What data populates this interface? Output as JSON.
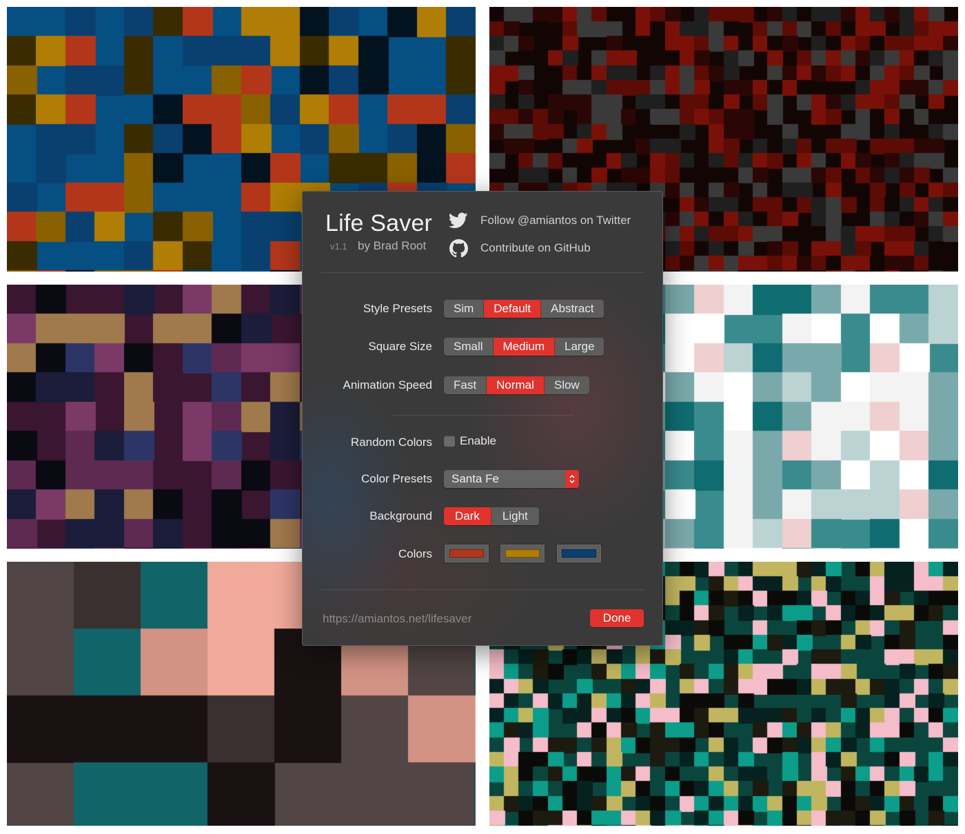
{
  "dialog": {
    "title": "Life Saver",
    "version": "v1.1",
    "author": "by Brad Root",
    "twitter_label": "Follow @amiantos on Twitter",
    "github_label": "Contribute on GitHub",
    "style_presets": {
      "label": "Style Presets",
      "options": [
        "Sim",
        "Default",
        "Abstract"
      ],
      "selected": "Default"
    },
    "square_size": {
      "label": "Square Size",
      "options": [
        "Small",
        "Medium",
        "Large"
      ],
      "selected": "Medium"
    },
    "animation_speed": {
      "label": "Animation Speed",
      "options": [
        "Fast",
        "Normal",
        "Slow"
      ],
      "selected": "Normal"
    },
    "random_colors": {
      "label": "Random Colors",
      "checkbox_label": "Enable",
      "checked": false
    },
    "color_presets": {
      "label": "Color Presets",
      "value": "Santa Fe"
    },
    "background": {
      "label": "Background",
      "options": [
        "Dark",
        "Light"
      ],
      "selected": "Dark"
    },
    "colors": {
      "label": "Colors",
      "swatches": [
        "#b3361b",
        "#b07d05",
        "#09406f"
      ]
    },
    "url": "https://amiantos.net/lifesaver",
    "done_label": "Done"
  },
  "theme": {
    "accent": "#e0332d",
    "panel": "#3a3a3a"
  },
  "previews": [
    {
      "name": "santa-fe-preview",
      "palette": [
        "#b3361b",
        "#b07d05",
        "#09406f",
        "#8a6100",
        "#3a2c00",
        "#02121f",
        "#064f83"
      ]
    },
    {
      "name": "red-dark-preview",
      "palette": [
        "#7a1108",
        "#5c0c05",
        "#3a3a3a",
        "#1f1f1f",
        "#2a0604",
        "#120605"
      ]
    },
    {
      "name": "purple-preview",
      "palette": [
        "#7a3966",
        "#2c3566",
        "#a07a4d",
        "#5e2a52",
        "#1b1d3a",
        "#0a0a12",
        "#3a1630"
      ]
    },
    {
      "name": "teal-light-preview",
      "palette": [
        "#0f6c70",
        "#7aa9ac",
        "#f3f3f3",
        "#efcfcf",
        "#bcd3d4",
        "#ffffff",
        "#3a8b8e"
      ]
    },
    {
      "name": "salmon-preview",
      "palette": [
        "#f1a99a",
        "#116468",
        "#3a302f",
        "#1a1212",
        "#d39384",
        "#524545"
      ]
    },
    {
      "name": "teal-pink-preview",
      "palette": [
        "#0c9e8a",
        "#f5bcc9",
        "#c2b560",
        "#052220",
        "#0a0a08",
        "#1d1a0f",
        "#0b463e"
      ]
    }
  ]
}
